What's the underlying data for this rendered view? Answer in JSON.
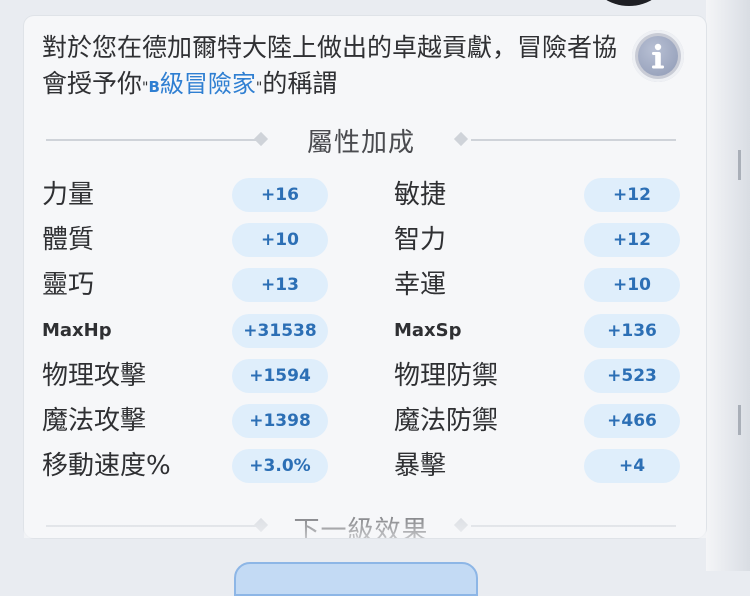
{
  "description": {
    "text_before": "對於您在德加爾特大陸上做出的卓越貢獻，冒險者協會授予你",
    "quote_open": "\"",
    "rank_letter": "B",
    "rank_text": "級冒險家",
    "quote_close": "\"",
    "text_after": "的稱謂"
  },
  "section_attributes": {
    "title": "屬性加成"
  },
  "section_next": {
    "title": "下一級效果"
  },
  "stats": [
    {
      "left_label": "力量",
      "left_value": "+16",
      "right_label": "敏捷",
      "right_value": "+12"
    },
    {
      "left_label": "體質",
      "left_value": "+10",
      "right_label": "智力",
      "right_value": "+12"
    },
    {
      "left_label": "靈巧",
      "left_value": "+13",
      "right_label": "幸運",
      "right_value": "+10"
    },
    {
      "left_label": "MaxHp",
      "left_value": "+31538",
      "right_label": "MaxSp",
      "right_value": "+136"
    },
    {
      "left_label": "物理攻擊",
      "left_value": "+1594",
      "right_label": "物理防禦",
      "right_value": "+523"
    },
    {
      "left_label": "魔法攻擊",
      "left_value": "+1398",
      "right_label": "魔法防禦",
      "right_value": "+466"
    },
    {
      "left_label": "移動速度%",
      "left_value": "+3.0%",
      "right_label": "暴擊",
      "right_value": "+4"
    }
  ],
  "icons": {
    "info": "info-icon"
  },
  "colors": {
    "accent_blue": "#2f7fd2",
    "pill_bg": "#dfeefb",
    "pill_text": "#2c6fb5"
  }
}
